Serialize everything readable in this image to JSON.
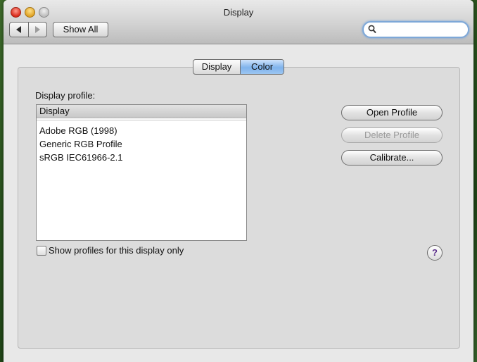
{
  "window": {
    "title": "Display"
  },
  "toolbar": {
    "show_all_label": "Show All",
    "back_icon": "back-arrow-icon",
    "forward_icon": "forward-arrow-icon",
    "search": {
      "value": "",
      "placeholder": ""
    }
  },
  "tabs": [
    {
      "label": "Display",
      "selected": false
    },
    {
      "label": "Color",
      "selected": true
    }
  ],
  "profile_section": {
    "label": "Display profile:",
    "list_header": "Display",
    "items": [
      "Adobe RGB (1998)",
      "Generic RGB Profile",
      "sRGB IEC61966-2.1"
    ]
  },
  "buttons": {
    "open_profile": "Open Profile",
    "delete_profile": "Delete Profile",
    "calibrate": "Calibrate..."
  },
  "checkbox": {
    "label": "Show profiles for this display only",
    "checked": false
  },
  "help": {
    "label": "?"
  },
  "colors": {
    "selected_tab": "#7fb3ec",
    "search_focus_ring": "#7ea8d8",
    "help_glyph": "#5b2d8a"
  }
}
